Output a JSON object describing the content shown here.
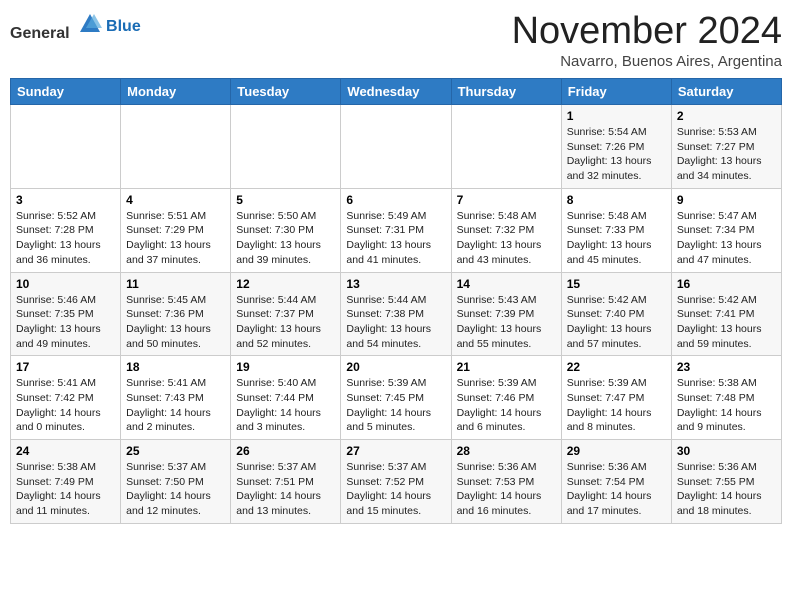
{
  "header": {
    "logo_general": "General",
    "logo_blue": "Blue",
    "title": "November 2024",
    "location": "Navarro, Buenos Aires, Argentina"
  },
  "calendar": {
    "headers": [
      "Sunday",
      "Monday",
      "Tuesday",
      "Wednesday",
      "Thursday",
      "Friday",
      "Saturday"
    ],
    "weeks": [
      [
        {
          "day": "",
          "detail": ""
        },
        {
          "day": "",
          "detail": ""
        },
        {
          "day": "",
          "detail": ""
        },
        {
          "day": "",
          "detail": ""
        },
        {
          "day": "",
          "detail": ""
        },
        {
          "day": "1",
          "detail": "Sunrise: 5:54 AM\nSunset: 7:26 PM\nDaylight: 13 hours\nand 32 minutes."
        },
        {
          "day": "2",
          "detail": "Sunrise: 5:53 AM\nSunset: 7:27 PM\nDaylight: 13 hours\nand 34 minutes."
        }
      ],
      [
        {
          "day": "3",
          "detail": "Sunrise: 5:52 AM\nSunset: 7:28 PM\nDaylight: 13 hours\nand 36 minutes."
        },
        {
          "day": "4",
          "detail": "Sunrise: 5:51 AM\nSunset: 7:29 PM\nDaylight: 13 hours\nand 37 minutes."
        },
        {
          "day": "5",
          "detail": "Sunrise: 5:50 AM\nSunset: 7:30 PM\nDaylight: 13 hours\nand 39 minutes."
        },
        {
          "day": "6",
          "detail": "Sunrise: 5:49 AM\nSunset: 7:31 PM\nDaylight: 13 hours\nand 41 minutes."
        },
        {
          "day": "7",
          "detail": "Sunrise: 5:48 AM\nSunset: 7:32 PM\nDaylight: 13 hours\nand 43 minutes."
        },
        {
          "day": "8",
          "detail": "Sunrise: 5:48 AM\nSunset: 7:33 PM\nDaylight: 13 hours\nand 45 minutes."
        },
        {
          "day": "9",
          "detail": "Sunrise: 5:47 AM\nSunset: 7:34 PM\nDaylight: 13 hours\nand 47 minutes."
        }
      ],
      [
        {
          "day": "10",
          "detail": "Sunrise: 5:46 AM\nSunset: 7:35 PM\nDaylight: 13 hours\nand 49 minutes."
        },
        {
          "day": "11",
          "detail": "Sunrise: 5:45 AM\nSunset: 7:36 PM\nDaylight: 13 hours\nand 50 minutes."
        },
        {
          "day": "12",
          "detail": "Sunrise: 5:44 AM\nSunset: 7:37 PM\nDaylight: 13 hours\nand 52 minutes."
        },
        {
          "day": "13",
          "detail": "Sunrise: 5:44 AM\nSunset: 7:38 PM\nDaylight: 13 hours\nand 54 minutes."
        },
        {
          "day": "14",
          "detail": "Sunrise: 5:43 AM\nSunset: 7:39 PM\nDaylight: 13 hours\nand 55 minutes."
        },
        {
          "day": "15",
          "detail": "Sunrise: 5:42 AM\nSunset: 7:40 PM\nDaylight: 13 hours\nand 57 minutes."
        },
        {
          "day": "16",
          "detail": "Sunrise: 5:42 AM\nSunset: 7:41 PM\nDaylight: 13 hours\nand 59 minutes."
        }
      ],
      [
        {
          "day": "17",
          "detail": "Sunrise: 5:41 AM\nSunset: 7:42 PM\nDaylight: 14 hours\nand 0 minutes."
        },
        {
          "day": "18",
          "detail": "Sunrise: 5:41 AM\nSunset: 7:43 PM\nDaylight: 14 hours\nand 2 minutes."
        },
        {
          "day": "19",
          "detail": "Sunrise: 5:40 AM\nSunset: 7:44 PM\nDaylight: 14 hours\nand 3 minutes."
        },
        {
          "day": "20",
          "detail": "Sunrise: 5:39 AM\nSunset: 7:45 PM\nDaylight: 14 hours\nand 5 minutes."
        },
        {
          "day": "21",
          "detail": "Sunrise: 5:39 AM\nSunset: 7:46 PM\nDaylight: 14 hours\nand 6 minutes."
        },
        {
          "day": "22",
          "detail": "Sunrise: 5:39 AM\nSunset: 7:47 PM\nDaylight: 14 hours\nand 8 minutes."
        },
        {
          "day": "23",
          "detail": "Sunrise: 5:38 AM\nSunset: 7:48 PM\nDaylight: 14 hours\nand 9 minutes."
        }
      ],
      [
        {
          "day": "24",
          "detail": "Sunrise: 5:38 AM\nSunset: 7:49 PM\nDaylight: 14 hours\nand 11 minutes."
        },
        {
          "day": "25",
          "detail": "Sunrise: 5:37 AM\nSunset: 7:50 PM\nDaylight: 14 hours\nand 12 minutes."
        },
        {
          "day": "26",
          "detail": "Sunrise: 5:37 AM\nSunset: 7:51 PM\nDaylight: 14 hours\nand 13 minutes."
        },
        {
          "day": "27",
          "detail": "Sunrise: 5:37 AM\nSunset: 7:52 PM\nDaylight: 14 hours\nand 15 minutes."
        },
        {
          "day": "28",
          "detail": "Sunrise: 5:36 AM\nSunset: 7:53 PM\nDaylight: 14 hours\nand 16 minutes."
        },
        {
          "day": "29",
          "detail": "Sunrise: 5:36 AM\nSunset: 7:54 PM\nDaylight: 14 hours\nand 17 minutes."
        },
        {
          "day": "30",
          "detail": "Sunrise: 5:36 AM\nSunset: 7:55 PM\nDaylight: 14 hours\nand 18 minutes."
        }
      ]
    ]
  }
}
